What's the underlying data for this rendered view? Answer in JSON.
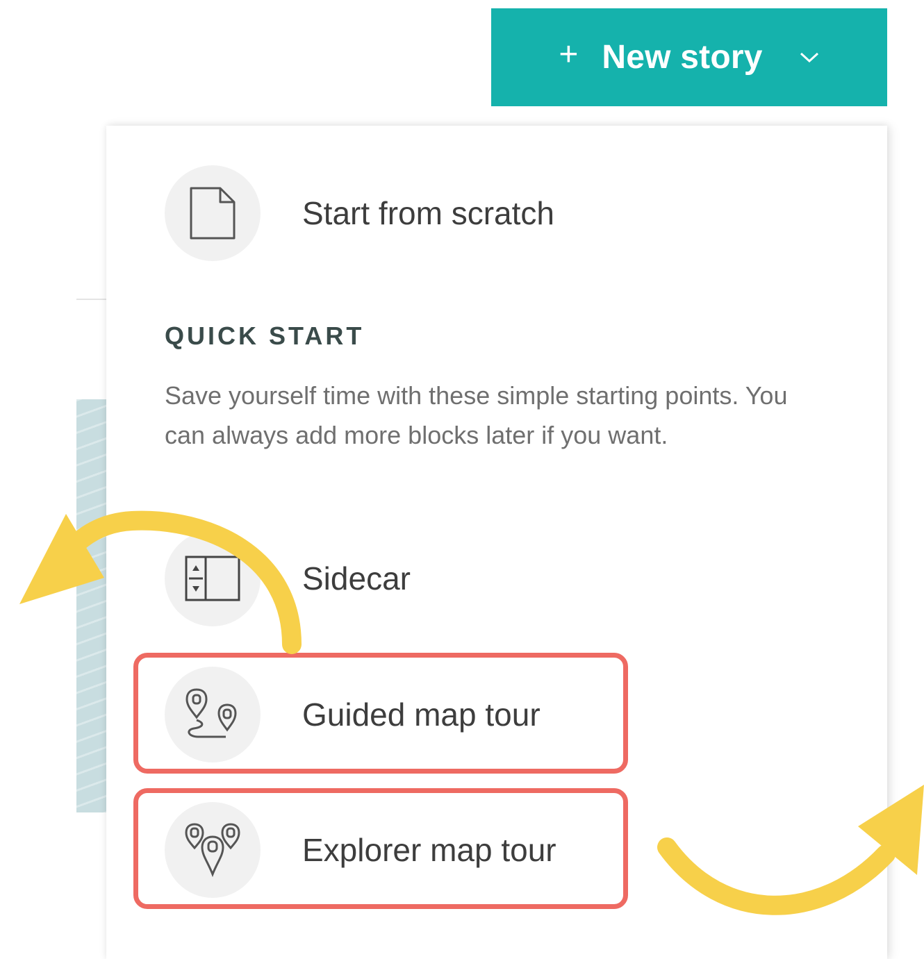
{
  "header": {
    "new_story_button": {
      "plus": "+",
      "label": "New story",
      "icon": "chevron-down-icon",
      "color": "#15b2ac"
    }
  },
  "dropdown": {
    "start_from_scratch": {
      "label": "Start from scratch",
      "icon": "blank-page-icon"
    },
    "quick_start": {
      "title": "QUICK START",
      "description": "Save yourself time with these simple starting points. You can always add more blocks later if you want.",
      "items": [
        {
          "label": "Sidecar",
          "icon": "sidecar-layout-icon"
        },
        {
          "label": "Guided map tour",
          "icon": "guided-tour-pins-icon",
          "highlighted": true
        },
        {
          "label": "Explorer map tour",
          "icon": "explorer-tour-pins-icon",
          "highlighted": true
        }
      ]
    }
  },
  "annotations": {
    "highlight_color": "#ee6a62",
    "arrow_color": "#f7d04a"
  }
}
